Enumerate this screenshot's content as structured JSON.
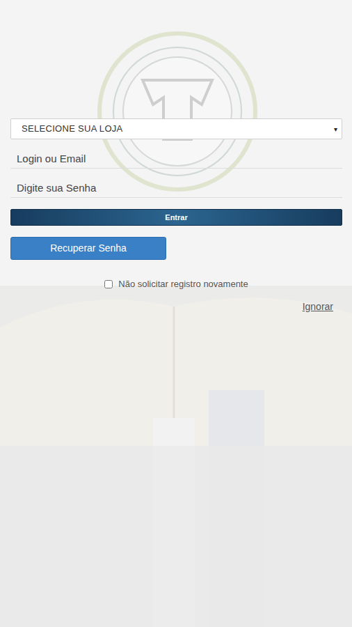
{
  "store_select": {
    "label": "SELECIONE SUA LOJA",
    "arrow": "▾"
  },
  "login": {
    "placeholder": "Login ou Email"
  },
  "password": {
    "placeholder": "Digite sua Senha"
  },
  "buttons": {
    "enter": "Entrar",
    "recover": "Recuperar Senha"
  },
  "remember": {
    "label": "Não solicitar registro novamente",
    "checked": false
  },
  "skip": "Ignorar"
}
